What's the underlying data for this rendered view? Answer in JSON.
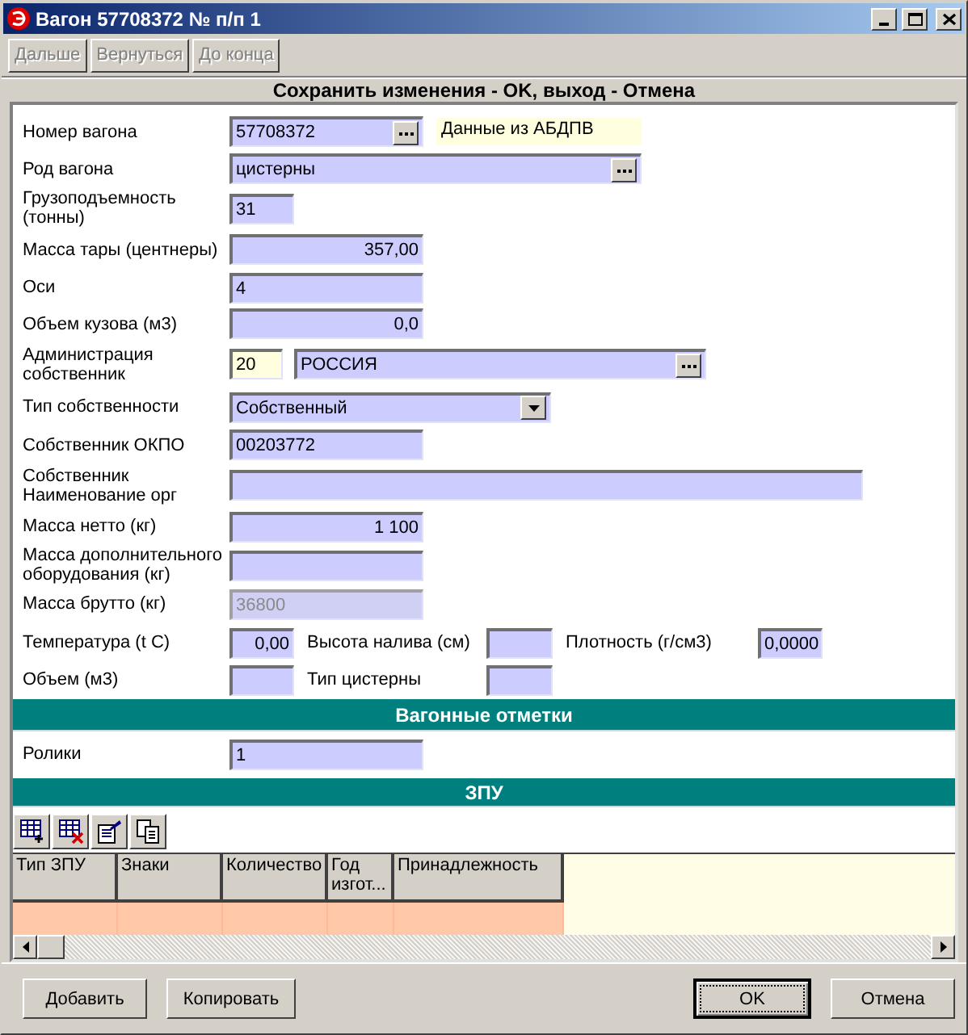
{
  "window": {
    "title": "Вагон 57708372 № п/п 1"
  },
  "nav_buttons": [
    {
      "label": "Дальше",
      "disabled": true
    },
    {
      "label": "Вернуться",
      "disabled": true
    },
    {
      "label": "До конца",
      "disabled": true
    }
  ],
  "hint": "Сохранить изменения - OK, выход - Отмена",
  "form": {
    "rows": [
      {
        "label": "Номер вагона",
        "items": [
          {
            "kind": "lookup",
            "value": "57708372",
            "disabled": false
          },
          {
            "kind": "note",
            "text": "Данные из АБДПВ"
          }
        ]
      },
      {
        "label": "Род вагона",
        "items": [
          {
            "kind": "lookup",
            "value": "цистерны",
            "disabled": false
          }
        ]
      },
      {
        "label": "Грузоподъемность (тонны)",
        "items": [
          {
            "kind": "text",
            "value": "31",
            "disabled": false
          }
        ]
      },
      {
        "label": "Масса тары (центнеры)",
        "items": [
          {
            "kind": "number",
            "value": "357,00",
            "disabled": false
          }
        ]
      },
      {
        "label": "Оси",
        "items": [
          {
            "kind": "text",
            "value": "4",
            "disabled": false
          }
        ]
      },
      {
        "label": "Объем кузова (м3)",
        "items": [
          {
            "kind": "number",
            "value": "0,0",
            "disabled": false
          }
        ]
      },
      {
        "label": "Администрация собственник",
        "items": [
          {
            "kind": "code",
            "value": "20",
            "disabled": false
          },
          {
            "kind": "lookup",
            "value": "РОССИЯ",
            "disabled": false
          }
        ]
      },
      {
        "label": "Тип собственности",
        "items": [
          {
            "kind": "select",
            "value": "Собственный",
            "disabled": false
          }
        ]
      },
      {
        "label": "Собственник ОКПО",
        "items": [
          {
            "kind": "text",
            "value": "00203772",
            "disabled": false
          }
        ]
      },
      {
        "label": "Собственник Наименование орг",
        "items": [
          {
            "kind": "text",
            "disabled": false
          }
        ]
      },
      {
        "label": "Масса нетто (кг)",
        "items": [
          {
            "kind": "number",
            "value": "1 100",
            "disabled": false
          }
        ]
      },
      {
        "label": "Масса дополнительного оборудования (кг)",
        "items": [
          {
            "kind": "text",
            "disabled": false
          }
        ]
      },
      {
        "label": "Масса брутто (кг)",
        "items": [
          {
            "kind": "text",
            "value": "36800",
            "disabled": true
          }
        ]
      },
      {
        "label": "Температура (t C)",
        "items": [
          {
            "kind": "number",
            "value": "0,00",
            "disabled": false
          },
          {
            "kind": "label",
            "text": "Высота налива (см)"
          },
          {
            "kind": "text",
            "disabled": false
          },
          {
            "kind": "label",
            "text": "Плотность (г/см3)"
          },
          {
            "kind": "text",
            "value": "0,0000",
            "disabled": false
          }
        ]
      },
      {
        "label": "Объем (м3)",
        "items": [
          {
            "kind": "text",
            "disabled": false
          },
          {
            "kind": "label",
            "text": "Тип цистерны"
          },
          {
            "kind": "text",
            "disabled": false
          }
        ]
      }
    ]
  },
  "marks": {
    "title": "Вагонные отметки",
    "rows": [
      {
        "label": "Ролики",
        "items": [
          {
            "kind": "text",
            "value": "1",
            "disabled": false
          }
        ]
      }
    ]
  },
  "zpu": {
    "title": "ЗПУ",
    "columns": [
      "Тип ЗПУ",
      "Знаки",
      "Количество",
      "Год изгот...",
      "Принадлежность"
    ]
  },
  "buttons": [
    {
      "label": "Добавить",
      "default": false
    },
    {
      "label": "Копировать",
      "default": false
    },
    {
      "label": "OK",
      "default": true
    },
    {
      "label": "Отмена",
      "default": false
    }
  ]
}
